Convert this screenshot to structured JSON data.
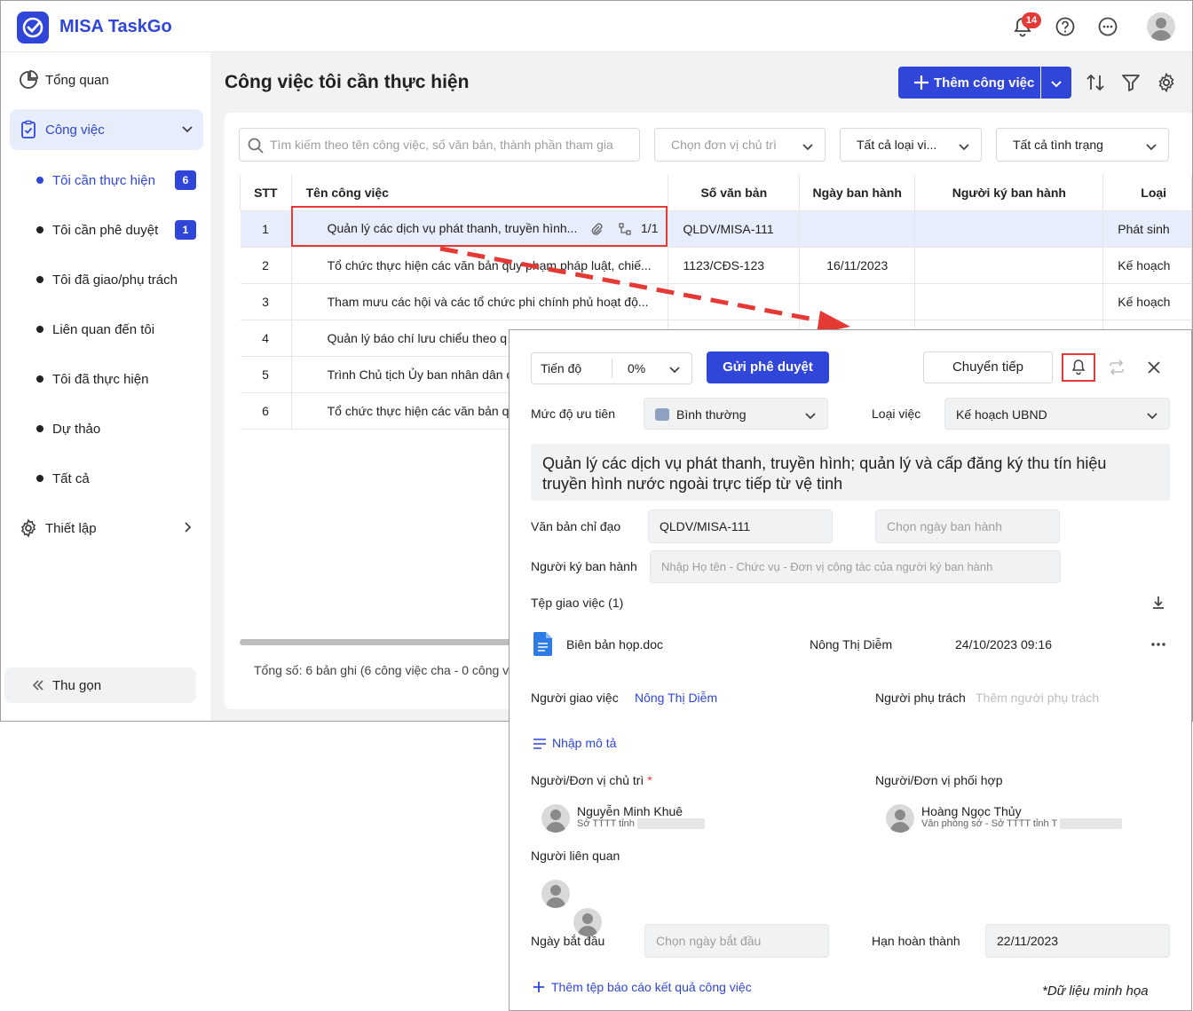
{
  "app": {
    "brand": "MISA TaskGo",
    "notification_count": "14"
  },
  "sidebar": {
    "overview": "Tổng quan",
    "tasks": "Công việc",
    "sub_items": [
      {
        "label": "Tôi cần thực hiện",
        "badge": "6"
      },
      {
        "label": "Tôi cần phê duyệt",
        "badge": "1"
      },
      {
        "label": "Tôi đã giao/phụ trách"
      },
      {
        "label": "Liên quan đến tôi"
      },
      {
        "label": "Tôi đã thực hiện"
      },
      {
        "label": "Dự thảo"
      },
      {
        "label": "Tất cả"
      }
    ],
    "settings": "Thiết lập",
    "collapse": "Thu gọn"
  },
  "main": {
    "title": "Công việc tôi cần thực hiện",
    "add_button": "Thêm công việc",
    "search_placeholder": "Tìm kiếm theo tên công việc, số văn bản, thành phần tham gia",
    "filters": {
      "unit": "Chọn đơn vị chủ trì",
      "type": "Tất cả loại vi...",
      "status": "Tất cả tình trạng"
    },
    "columns": [
      "STT",
      "Tên công việc",
      "Số văn bản",
      "Ngày ban hành",
      "Người ký ban hành",
      "Loại"
    ],
    "rows": [
      {
        "stt": "1",
        "name": "Quản lý các dịch vụ phát thanh, truyền hình...",
        "sub": "1/1",
        "doc": "QLDV/MISA-111",
        "date": "",
        "signer": "",
        "type": "Phát sinh"
      },
      {
        "stt": "2",
        "name": "Tổ chức thực hiện các văn bản quy phạm pháp luật, chiế...",
        "doc": "1123/CĐS-123",
        "date": "16/11/2023",
        "signer": "",
        "type": "Kế hoạch"
      },
      {
        "stt": "3",
        "name": "Tham mưu các hội và các tổ chức phi chính phủ hoạt độ...",
        "doc": "",
        "date": "",
        "signer": "",
        "type": "Kế hoạch"
      },
      {
        "stt": "4",
        "name": "Quản lý báo chí lưu chiểu theo q",
        "doc": "",
        "date": "",
        "signer": "",
        "type": ""
      },
      {
        "stt": "5",
        "name": "Trình Chủ tịch Ủy ban nhân dân c",
        "doc": "",
        "date": "",
        "signer": "",
        "type": ""
      },
      {
        "stt": "6",
        "name": "Tổ chức thực hiện các văn bản qu",
        "doc": "",
        "date": "",
        "signer": "",
        "type": ""
      }
    ],
    "total": "Tổng số: 6 bản ghi (6 công việc cha - 0 công v"
  },
  "detail": {
    "progress_label": "Tiến độ",
    "progress_value": "0%",
    "submit_button": "Gửi phê duyệt",
    "forward_button": "Chuyển tiếp",
    "priority_label": "Mức độ ưu tiên",
    "priority_value": "Bình thường",
    "task_type_label": "Loại việc",
    "task_type_value": "Kế hoạch UBND",
    "task_title": "Quản lý các dịch vụ phát thanh, truyền hình; quản lý và cấp đăng ký thu tín hiệu truyền hình nước ngoài trực tiếp từ vệ tinh",
    "directive_label": "Văn bản chỉ đạo",
    "directive_value": "QLDV/MISA-111",
    "issue_date_placeholder": "Chọn ngày ban hành",
    "signer_label": "Người ký ban hành",
    "signer_placeholder": "Nhập Họ tên - Chức vụ - Đơn vị công tác của người ký ban hành",
    "files_label": "Tệp giao việc (1)",
    "file": {
      "name": "Biên bản họp.doc",
      "owner": "Nông Thị Diễm",
      "time": "24/10/2023 09:16"
    },
    "assigner_label": "Người giao việc",
    "assigner_value": "Nông Thị Diễm",
    "owner_label": "Người phụ trách",
    "owner_placeholder": "Thêm người phụ trách",
    "description_link": "Nhập mô tả",
    "lead_label": "Người/Đơn vị chủ trì",
    "lead": {
      "name": "Nguyễn Minh Khuê",
      "org": "Sở TTTT tỉnh"
    },
    "cooperate_label": "Người/Đơn vị phối hợp",
    "cooperate": {
      "name": "Hoàng Ngọc Thủy",
      "org": "Văn phòng sở - Sở TTTT tỉnh T"
    },
    "related_label": "Người liên quan",
    "start_label": "Ngày bắt đầu",
    "start_placeholder": "Chọn ngày bắt đầu",
    "due_label": "Hạn hoàn thành",
    "due_value": "22/11/2023",
    "add_report_link": "Thêm tệp báo cáo kết quả công việc"
  },
  "footnote": "*Dữ liệu minh họa",
  "colors": {
    "primary": "#2f46d9",
    "highlight": "#e53935",
    "badge": "#e53935"
  }
}
